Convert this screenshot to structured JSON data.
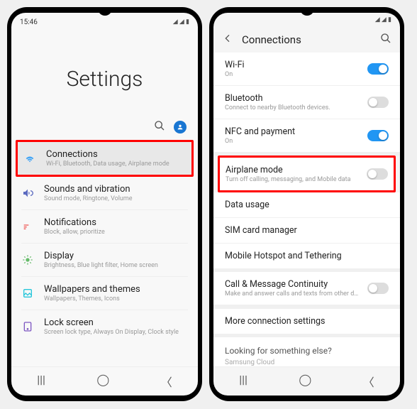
{
  "status": {
    "time": "15:46",
    "icons": "◢ ◢ ▮"
  },
  "left": {
    "title": "Settings",
    "items": [
      {
        "title": "Connections",
        "sub": "Wi-Fi, Bluetooth, Data usage, Airplane mode",
        "iconColor": "#42a5f5"
      },
      {
        "title": "Sounds and vibration",
        "sub": "Sound mode, Ringtone, Volume",
        "iconColor": "#5c6bc0"
      },
      {
        "title": "Notifications",
        "sub": "Block, allow, prioritize",
        "iconColor": "#ef5350"
      },
      {
        "title": "Display",
        "sub": "Brightness, Blue light filter, Home screen",
        "iconColor": "#66bb6a"
      },
      {
        "title": "Wallpapers and themes",
        "sub": "Wallpapers, Themes, Icons",
        "iconColor": "#26c6da"
      },
      {
        "title": "Lock screen",
        "sub": "Screen lock type, Always On Display, Clock style",
        "iconColor": "#7e57c2"
      }
    ]
  },
  "right": {
    "header": "Connections",
    "group1": [
      {
        "title": "Wi-Fi",
        "sub": "On",
        "toggle": true
      },
      {
        "title": "Bluetooth",
        "sub": "Connect to nearby Bluetooth devices.",
        "toggle": false
      },
      {
        "title": "NFC and payment",
        "sub": "On",
        "toggle": true
      }
    ],
    "airplane": {
      "title": "Airplane mode",
      "sub": "Turn off calling, messaging, and Mobile data",
      "toggle": false
    },
    "group2": [
      {
        "title": "Data usage"
      },
      {
        "title": "SIM card manager"
      },
      {
        "title": "Mobile Hotspot and Tethering"
      }
    ],
    "continuity": {
      "title": "Call & Message Continuity",
      "sub": "Make and answer calls and texts from other devices.",
      "toggle": false
    },
    "more": "More connection settings",
    "footer": "Looking for something else?",
    "cut": "Samsung Cloud"
  }
}
